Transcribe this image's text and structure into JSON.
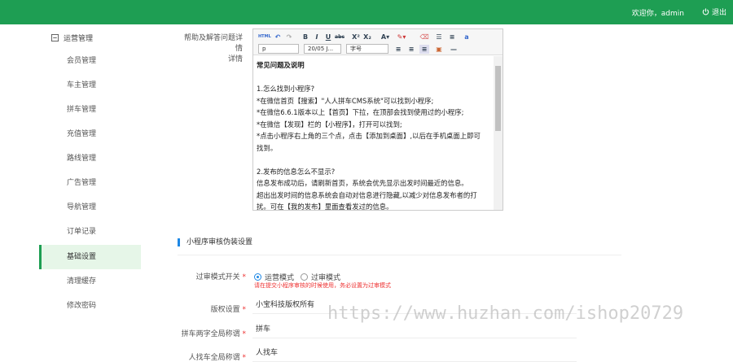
{
  "header": {
    "welcome": "欢迎你，admin",
    "logout": "退出"
  },
  "sidebar": {
    "group_label": "运营管理",
    "items": [
      {
        "label": "会员管理"
      },
      {
        "label": "车主管理"
      },
      {
        "label": "拼车管理"
      },
      {
        "label": "充值管理"
      },
      {
        "label": "路线管理"
      },
      {
        "label": "广告管理"
      },
      {
        "label": "导航管理"
      },
      {
        "label": "订单记录"
      },
      {
        "label": "基础设置"
      },
      {
        "label": "清理缓存"
      },
      {
        "label": "修改密码"
      }
    ],
    "active": "基础设置"
  },
  "form": {
    "help_label": "帮助及解答问题详情",
    "help_label_2": "详情",
    "editor": {
      "toolbar_icons": [
        "html-icon",
        "undo-icon",
        "redo-icon",
        "bold-icon",
        "italic-icon",
        "underline-icon",
        "strikethrough-icon",
        "superscript-icon",
        "subscript-icon",
        "font-color-icon",
        "highlight-icon",
        "eraser-icon",
        "ordered-list-icon",
        "unordered-list-icon",
        "text-style-icon",
        "align-left-icon",
        "align-center-icon",
        "align-right-icon",
        "image-icon",
        "horizontal-rule-icon"
      ],
      "paragraph_select": "p",
      "size_select": "20/05 J...",
      "font_select": "字号",
      "lines": [
        "常见问题及说明",
        "",
        "1.怎么找到小程序?",
        "*在微信首页【搜索】\"人人拼车CMS系统\"可以找到小程序;",
        "*在微信6.6.1版本以上【首页】下拉，在顶部会找到使用过的小程序;",
        "*在微信【发现】栏的【小程序】，打开可以找到;",
        "*点击小程序右上角的三个点，点击【添加到桌面】,以后在手机桌面上即可",
        "找到。",
        "",
        "2.发布的信息怎么不显示?",
        "信息发布成功后，请刷新首页，系统会优先显示出发时间最近的信息。",
        "超出出发时间的信息系统会自动对信息进行隐藏,以减少对信息发布者的打",
        "扰。可在【我的发布】里面查看发过的信息。"
      ]
    },
    "section_title": "小程序审核伪装设置",
    "audit_switch": {
      "label": "过审模式开关",
      "options": [
        "运营模式",
        "过审模式"
      ],
      "selected": "运营模式",
      "hint": "请在提交小程序审核的时候使用，务必设置为过审模式"
    },
    "copyright": {
      "label": "版权设置",
      "value": "小宝科技版权所有"
    },
    "carpool_name": {
      "label": "拼车两字全局称谓",
      "value": "拼车"
    },
    "find_car_name": {
      "label": "人找车全局称谓",
      "value": "人找车"
    }
  },
  "watermark": "https://www.huzhan.com/ishop20729",
  "colors": {
    "brand": "#1e9e53",
    "accent": "#1e88e5",
    "required": "#e33333"
  }
}
